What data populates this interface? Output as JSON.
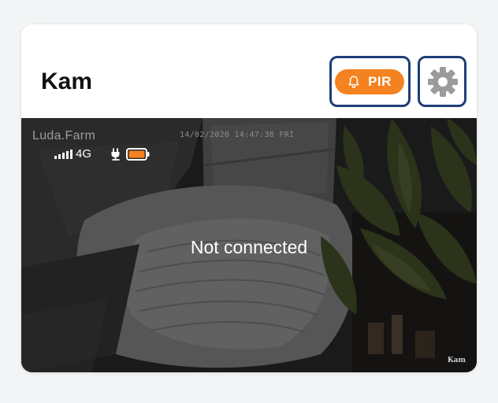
{
  "camera": {
    "name": "Kam"
  },
  "actions": {
    "pir_label": "PIR",
    "pir_icon": "bell-icon",
    "settings_icon": "gear-icon",
    "pir_color": "#f58220",
    "highlight_color": "#1f3e78"
  },
  "video": {
    "brand": "Luda.Farm",
    "timestamp": "14/02/2020 14:47:38 FRI",
    "network": "4G",
    "signal_icon": "signal-bars-icon",
    "power_icon": "plug-icon",
    "battery_icon": "battery-icon",
    "battery_color": "#f58220",
    "status_message": "Not connected",
    "watermark": "Kam"
  }
}
